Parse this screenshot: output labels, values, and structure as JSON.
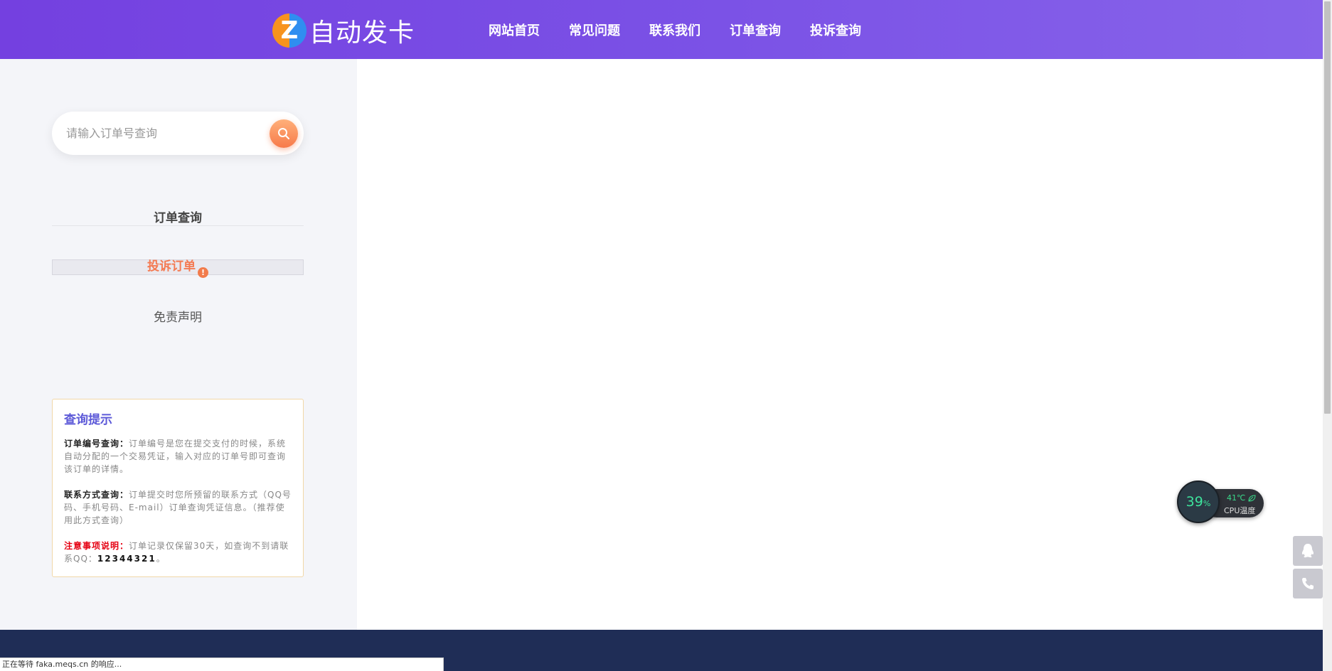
{
  "header": {
    "logo_letter": "Z",
    "logo_text": "自动发卡",
    "nav": [
      "网站首页",
      "常见问题",
      "联系我们",
      "订单查询",
      "投诉查询"
    ]
  },
  "sidebar": {
    "search_placeholder": "请输入订单号查询",
    "menu": {
      "order_query": "订单查询",
      "complaint": "投诉订单",
      "complaint_badge": "!",
      "disclaimer": "免责声明"
    },
    "tips": {
      "title": "查询提示",
      "order_no_label": "订单编号查询：",
      "order_no_text": "订单编号是您在提交支付的时候，系统自动分配的一个交易凭证，输入对应的订单号即可查询该订单的详情。",
      "contact_label": "联系方式查询：",
      "contact_text": "订单提交时您所预留的联系方式（QQ号码、手机号码、E-mail）订单查询凭证信息。（推荐使用此方式查询）",
      "notice_label": "注意事项说明：",
      "notice_text": "订单记录仅保留30天，如查询不到请联系QQ：",
      "notice_qq": "12344321",
      "notice_end": "。"
    }
  },
  "cpu_widget": {
    "percent": "39",
    "percent_unit": "%",
    "temp": "41℃",
    "label": "CPU温度"
  },
  "statusbar": {
    "text": "正在等待 faka.meqs.cn 的响应..."
  },
  "colors": {
    "header_start": "#7440e0",
    "header_end": "#8763ea",
    "accent_orange": "#f47a52",
    "footer": "#1f2d56",
    "tip_title": "#5c59d8"
  },
  "icons": {
    "search": "search-icon",
    "qq": "qq-icon",
    "phone": "phone-icon",
    "leaf": "leaf-icon"
  }
}
